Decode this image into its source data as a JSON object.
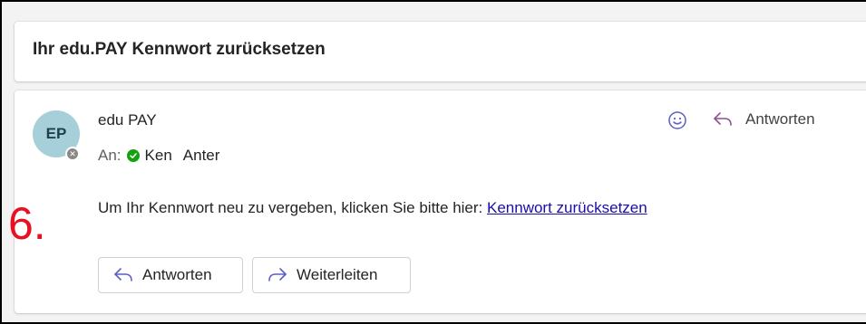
{
  "email": {
    "subject": "Ihr edu.PAY Kennwort zurücksetzen",
    "sender": {
      "initials": "EP",
      "name": "edu PAY",
      "presence_icon": "blocked-presence-icon"
    },
    "to": {
      "label": "An:",
      "recipient_first": "Ken",
      "recipient_last": "Anter",
      "status_icon": "check-circle-icon",
      "status_color": "#13a10e"
    },
    "actions": {
      "emoji_icon": "smiley-icon",
      "reply_label": "Antworten"
    },
    "body": {
      "text": "Um Ihr Kennwort neu zu vergeben, klicken Sie bitte hier: ",
      "link_text": "Kennwort zurücksetzen",
      "link_color": "#1a0dab"
    },
    "footer_buttons": {
      "reply_label": "Antworten",
      "forward_label": "Weiterleiten",
      "accent_color": "#5b5fc7"
    }
  },
  "annotation": {
    "step_number": "6.",
    "color": "#e81123"
  }
}
